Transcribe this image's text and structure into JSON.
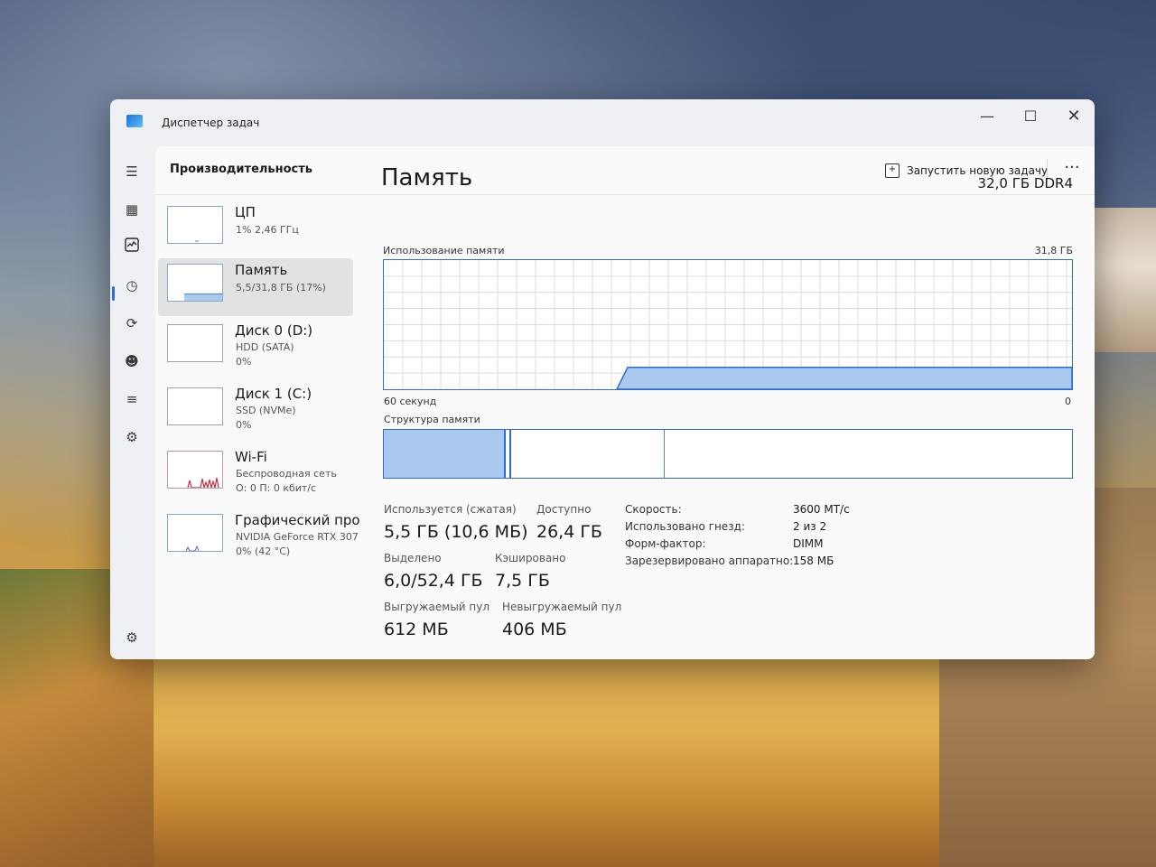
{
  "window": {
    "title": "Диспетчер задач"
  },
  "header": {
    "page_title": "Производительность",
    "new_task_label": "Запустить новую задачу",
    "more": "···"
  },
  "sidebar": {
    "items": [
      {
        "name": "ЦП",
        "sub1": "1% 2,46 ГГц",
        "sub2": ""
      },
      {
        "name": "Память",
        "sub1": "5,5/31,8 ГБ (17%)",
        "sub2": ""
      },
      {
        "name": "Диск 0 (D:)",
        "sub1": "HDD (SATA)",
        "sub2": "0%"
      },
      {
        "name": "Диск 1 (C:)",
        "sub1": "SSD (NVMe)",
        "sub2": "0%"
      },
      {
        "name": "Wi-Fi",
        "sub1": "Беспроводная сеть",
        "sub2": "О: 0 П: 0 кбит/с"
      },
      {
        "name": "Графический про",
        "sub1": "NVIDIA GeForce RTX 307",
        "sub2": "0% (42 °C)"
      }
    ]
  },
  "memory": {
    "title": "Память",
    "total": "32,0 ГБ DDR4",
    "usage_label": "Использование памяти",
    "usage_max": "31,8 ГБ",
    "axis_left": "60 секунд",
    "axis_right": "0",
    "structure_label": "Структура памяти",
    "in_use_fraction": 0.17
  },
  "stats": {
    "in_use_label": "Используется (сжатая)",
    "in_use_value": "5,5 ГБ (10,6 МБ)",
    "available_label": "Доступно",
    "available_value": "26,4 ГБ",
    "committed_label": "Выделено",
    "committed_value": "6,0/52,4 ГБ",
    "cached_label": "Кэшировано",
    "cached_value": "7,5 ГБ",
    "paged_label": "Выгружаемый пул",
    "paged_value": "612 МБ",
    "nonpaged_label": "Невыгружаемый пул",
    "nonpaged_value": "406 МБ"
  },
  "properties": [
    {
      "label": "Скорость:",
      "value": "3600 МТ/с"
    },
    {
      "label": "Использовано гнезд:",
      "value": "2 из 2"
    },
    {
      "label": "Форм-фактор:",
      "value": "DIMM"
    },
    {
      "label": "Зарезервировано аппаратно:",
      "value": "158 МБ"
    }
  ],
  "colors": {
    "accent": "#2e6bd3",
    "fill": "#a9c9ef"
  },
  "icons": {
    "nav": [
      "hamburger-icon",
      "processes-icon",
      "performance-icon",
      "history-icon",
      "startup-icon",
      "users-icon",
      "details-icon",
      "services-icon",
      "settings-icon"
    ]
  }
}
